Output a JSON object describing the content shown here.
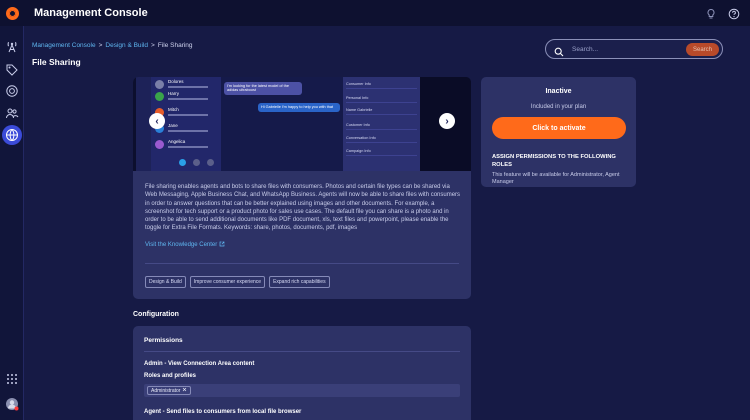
{
  "app": {
    "title": "Management Console"
  },
  "breadcrumb": {
    "items": [
      "Management Console",
      "Design & Build",
      "File Sharing"
    ],
    "sep": ">"
  },
  "page": {
    "title": "File Sharing"
  },
  "search": {
    "placeholder": "Search...",
    "button": "Search"
  },
  "carousel": {
    "contacts": [
      "Dolores",
      "Harry",
      "Mitch",
      "Jane",
      "Angelica"
    ],
    "bubble_in": "I'm looking for the latest model of the adidas ultraboost",
    "bubble_out": "Hi Gabrielle I'm happy to help you with that",
    "panel_items": [
      "Consumer Info",
      "Personal Info",
      "Name   Gabrielle",
      "Customer Info",
      "Conversation Info",
      "Campaign Info"
    ],
    "prev": "‹",
    "next": "›",
    "dots": 3,
    "active_dot": 0
  },
  "feature": {
    "description": "File sharing enables agents and bots to share files with consumers. Photos and certain file types can be shared via Web Messaging, Apple Business Chat, and WhatsApp Business. Agents will now be able to share files with consumers in order to answer questions that can be better explained using images and other documents. For example, a screenshot for tech support or a product photo for sales use cases. The default file you can share is a photo and in order to be able to send additional documents like PDF document, xls, text files and powerpoint, please enable the toggle for Extra File Formats. Keywords: share, photos, documents, pdf, images",
    "link": "Visit the Knowledge Center",
    "tags": [
      "Design & Build",
      "Improve consumer experience",
      "Expand rich capabilities"
    ]
  },
  "status": {
    "title": "Inactive",
    "plan": "Included in your plan",
    "activate": "Click to activate",
    "assign_heading": "ASSIGN PERMISSIONS TO THE FOLLOWING ROLES",
    "assign_text": "This feature will be available for Administrator, Agent Manager"
  },
  "config": {
    "heading": "Configuration",
    "permissions_title": "Permissions",
    "admin_label": "Admin - View Connection Area content",
    "roles_label": "Roles and profiles",
    "role_chip": "Administrator",
    "agent_label": "Agent - Send files to consumers from local file browser"
  },
  "colors": {
    "accent": "#ff6a1a",
    "link": "#5fb6f0",
    "background": "#161a45",
    "card": "#2d3266"
  },
  "icons": [
    "settings-gear-logo",
    "bulb-icon",
    "help-icon",
    "broadcast-icon",
    "tag-icon",
    "target-icon",
    "people-icon",
    "globe-icon",
    "apps-grid-icon",
    "avatar"
  ]
}
